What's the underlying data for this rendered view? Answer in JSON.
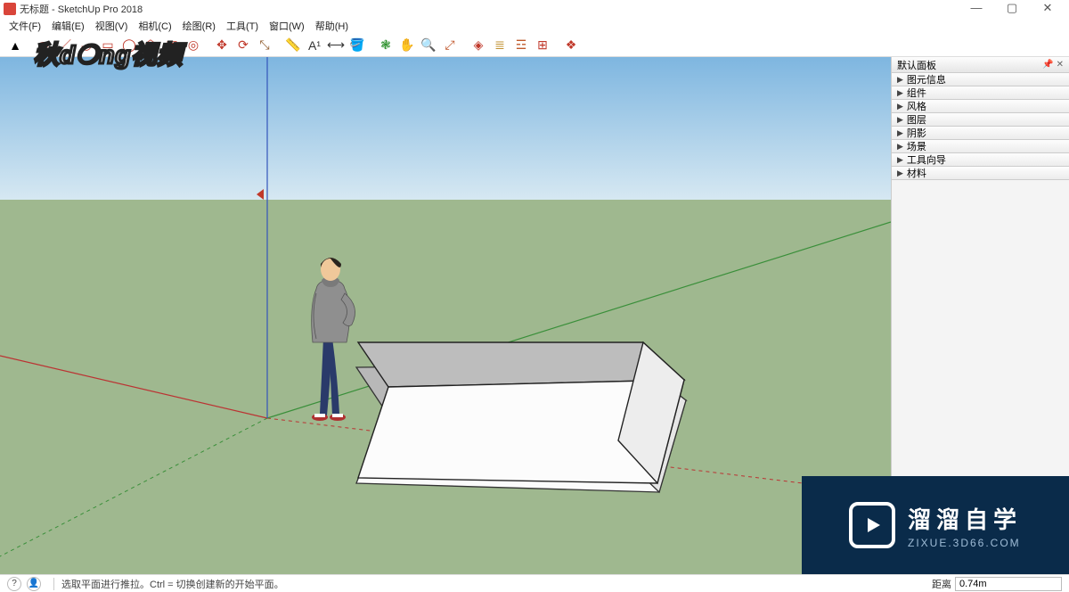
{
  "window": {
    "title": "无标题 - SketchUp Pro 2018",
    "minimize": "—",
    "maximize": "▢",
    "close": "✕"
  },
  "menu": {
    "items": [
      "文件(F)",
      "编辑(E)",
      "视图(V)",
      "相机(C)",
      "绘图(R)",
      "工具(T)",
      "窗口(W)",
      "帮助(H)"
    ]
  },
  "toolbar": {
    "tools": [
      {
        "name": "select-tool",
        "glyph": "▲",
        "color": "#000"
      },
      {
        "name": "sep"
      },
      {
        "name": "eraser-tool",
        "glyph": "⬭",
        "color": "#c0392b"
      },
      {
        "name": "line-tool",
        "glyph": "／",
        "color": "#c0392b"
      },
      {
        "name": "arc-tool",
        "glyph": "◡",
        "color": "#c0392b"
      },
      {
        "name": "rectangle-tool",
        "glyph": "▭",
        "color": "#c0392b"
      },
      {
        "name": "circle-tool",
        "glyph": "◯",
        "color": "#c0392b"
      },
      {
        "name": "polygon-tool",
        "glyph": "⬠",
        "color": "#c0392b"
      },
      {
        "name": "pushpull-tool",
        "glyph": "▣",
        "color": "#c0392b"
      },
      {
        "name": "offset-tool",
        "glyph": "◎",
        "color": "#c0392b"
      },
      {
        "name": "sep"
      },
      {
        "name": "move-tool",
        "glyph": "✥",
        "color": "#c0392b"
      },
      {
        "name": "rotate-tool",
        "glyph": "⟳",
        "color": "#c0392b"
      },
      {
        "name": "scale-tool",
        "glyph": "⤡",
        "color": "#8e5a2b"
      },
      {
        "name": "sep"
      },
      {
        "name": "tape-tool",
        "glyph": "📏",
        "color": "#e0a800"
      },
      {
        "name": "text-tool",
        "glyph": "A¹",
        "color": "#333"
      },
      {
        "name": "dimension-tool",
        "glyph": "⟷",
        "color": "#333"
      },
      {
        "name": "paintbucket-tool",
        "glyph": "🪣",
        "color": "#8e5a2b"
      },
      {
        "name": "sep"
      },
      {
        "name": "orbit-tool",
        "glyph": "❃",
        "color": "#2a8f2a"
      },
      {
        "name": "pan-tool",
        "glyph": "✋",
        "color": "#d28a2a"
      },
      {
        "name": "zoom-tool",
        "glyph": "🔍",
        "color": "#555"
      },
      {
        "name": "zoom-extents-tool",
        "glyph": "⤢",
        "color": "#c0562b"
      },
      {
        "name": "sep"
      },
      {
        "name": "warehouse-tool",
        "glyph": "◈",
        "color": "#c0392b"
      },
      {
        "name": "layers-tool",
        "glyph": "≣",
        "color": "#c09030"
      },
      {
        "name": "outliner-tool",
        "glyph": "☲",
        "color": "#c05a2b"
      },
      {
        "name": "components-tool",
        "glyph": "⊞",
        "color": "#c0392b"
      },
      {
        "name": "sep"
      },
      {
        "name": "extension-tool",
        "glyph": "❖",
        "color": "#c0392b"
      }
    ]
  },
  "sidepanel": {
    "title": "默认面板",
    "trays": [
      "图元信息",
      "组件",
      "风格",
      "图层",
      "阴影",
      "场景",
      "工具向导",
      "材料"
    ]
  },
  "statusbar": {
    "hint": "选取平面进行推拉。Ctrl = 切换创建新的开始平面。",
    "measure_label": "距离",
    "measure_value": "0.74m"
  },
  "overlay": {
    "logo": "秋d❍ng视频"
  },
  "watermark": {
    "line1": "溜溜自学",
    "line2": "ZIXUE.3D66.COM"
  },
  "scene": {
    "axes": {
      "x_color": "#b33",
      "y_color": "#3a8f3a",
      "z_color": "#3355bb"
    },
    "ground_color": "#9fb88f",
    "sky_top": "#7eb6e0",
    "sky_bottom": "#d6e8f2"
  }
}
